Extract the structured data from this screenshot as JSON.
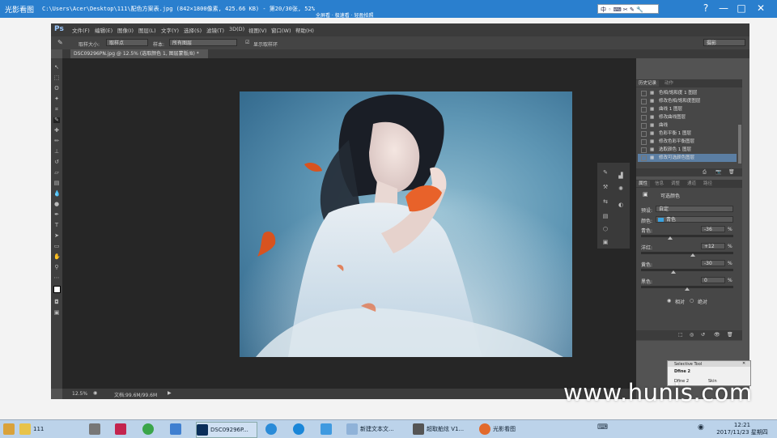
{
  "viewer": {
    "app_name": "光影看图",
    "path": "C:\\Users\\Acer\\Desktop\\111\\配色方案表.jpg (842×1800像素, 425.66 KB) - 第20/30张, 52%",
    "banner": "全屏看 · 极速看 · 轻盈拍照",
    "ime": "中 ◦ ⌨ ✂ ✎ 🔧",
    "buttons": {
      "min": "—",
      "max": "□",
      "close": "✕",
      "help": "?"
    }
  },
  "ps": {
    "logo": "Ps",
    "menu": [
      "文件(F)",
      "编辑(E)",
      "图像(I)",
      "图层(L)",
      "文字(Y)",
      "选择(S)",
      "滤镜(T)",
      "3D(D)",
      "视图(V)",
      "窗口(W)",
      "帮助(H)"
    ],
    "options": {
      "sample_size_label": "取样大小:",
      "sample_size_value": "取样点",
      "sample_label": "样本:",
      "sample_value": "所有图层",
      "show_ring_label": "显示取样环",
      "workspace": "摄影"
    },
    "doc_tab": "DSC09296PN.jpg @ 12.5% (选取颜色 1, 图层蒙版/8) *",
    "status": {
      "zoom": "12.5%",
      "doc": "文档:99.6M/99.6M"
    }
  },
  "history": {
    "tabs": [
      "历史记录",
      "动作"
    ],
    "rows": [
      "色相/饱和度 1 图层",
      "修改色相/饱和度图层",
      "曲线 1 图层",
      "修改曲线图层",
      "曲线",
      "色彩平衡 1 图层",
      "修改色彩平衡图层",
      "选取颜色 1 图层",
      "修改可选颜色图层"
    ]
  },
  "properties": {
    "tabs": [
      "属性",
      "信息",
      "调整",
      "通道",
      "路径"
    ],
    "title": "可选颜色",
    "preset_label": "预设:",
    "preset_value": "自定",
    "colors_label": "颜色:",
    "colors_value": "青色",
    "colors_swatch": "#3aa3e0",
    "sliders": [
      {
        "label": "青色:",
        "value": "-36",
        "unit": "%",
        "fraction": 0.32
      },
      {
        "label": "洋红:",
        "value": "+12",
        "unit": "%",
        "fraction": 0.56
      },
      {
        "label": "黄色:",
        "value": "-30",
        "unit": "%",
        "fraction": 0.35
      },
      {
        "label": "黑色:",
        "value": "0",
        "unit": "%",
        "fraction": 0.5
      }
    ],
    "method_relative": "相对",
    "method_absolute": "绝对"
  },
  "selective_tool": {
    "title": "Selective Tool",
    "line1": "Dfine 2",
    "line2": "Dfine 2",
    "line3": "Skin"
  },
  "watermark": "www.hunis.com",
  "taskbar": {
    "items": [
      "111",
      "",
      "",
      "",
      "",
      "DSC09296P...",
      "",
      "",
      "",
      "新建文本文...",
      "超取舶炫 V1...",
      "光影看图"
    ],
    "time": "12:21",
    "date": "2017/11/23 星期四"
  }
}
